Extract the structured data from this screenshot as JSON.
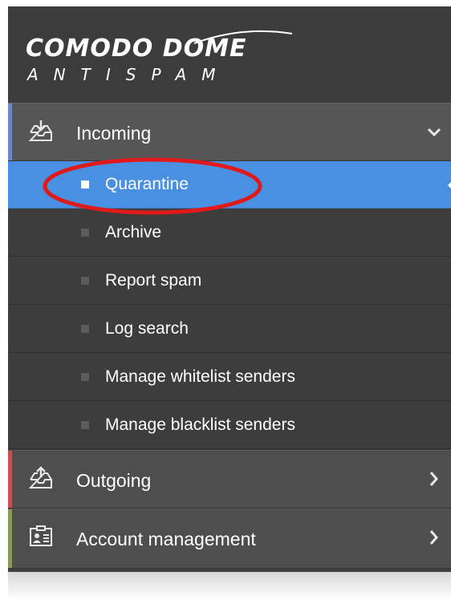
{
  "logo": {
    "line1": "COMODO DOME",
    "line2": "ANTISPAM"
  },
  "sections": {
    "incoming": {
      "label": "Incoming",
      "icon": "inbox-download-icon",
      "stripe_color": "#6f86c6",
      "expanded": true
    },
    "outgoing": {
      "label": "Outgoing",
      "icon": "inbox-upload-icon",
      "stripe_color": "#c55050",
      "expanded": false
    },
    "account": {
      "label": "Account management",
      "icon": "contact-card-icon",
      "stripe_color": "#8a9a54",
      "expanded": false
    }
  },
  "incoming_items": [
    {
      "label": "Quarantine",
      "active": true
    },
    {
      "label": "Archive",
      "active": false
    },
    {
      "label": "Report spam",
      "active": false
    },
    {
      "label": "Log search",
      "active": false
    },
    {
      "label": "Manage whitelist senders",
      "active": false
    },
    {
      "label": "Manage blacklist senders",
      "active": false
    }
  ],
  "colors": {
    "sidebar_bg": "#3f3f3f",
    "active_item": "#4a90e2",
    "annotation_circle": "#e0191b"
  }
}
